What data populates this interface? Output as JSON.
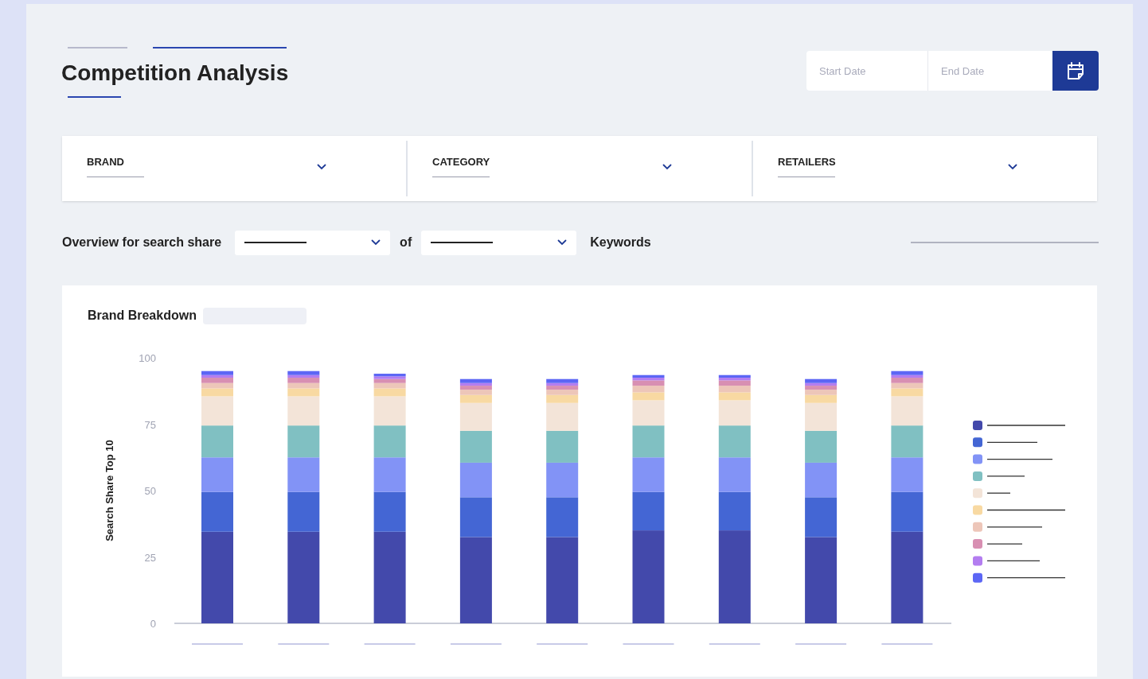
{
  "tabs": [
    {
      "selected": false
    },
    {
      "selected": true
    }
  ],
  "title": "Competition Analysis",
  "date_range": {
    "start_placeholder": "Start Date",
    "end_placeholder": "End Date"
  },
  "filters": [
    {
      "label": "BRAND"
    },
    {
      "label": "CATEGORY"
    },
    {
      "label": "RETAILERS"
    }
  ],
  "overview": {
    "label": "Overview for search share",
    "connector": "of",
    "suffix": "Keywords"
  },
  "brand_breakdown": {
    "chart_data": {
      "type": "bar",
      "stacked": true,
      "title": "Brand Breakdown",
      "ylabel": "Search Share Top 10",
      "ylim": [
        0,
        100
      ],
      "yticks": [
        0,
        25,
        50,
        75,
        100
      ],
      "series": [
        {
          "color": "#4349ab",
          "values": [
            34.5,
            34.5,
            34.5,
            32.5,
            32.5,
            35,
            35,
            32.5,
            34.5
          ]
        },
        {
          "color": "#4466d4",
          "values": [
            15,
            15,
            15,
            15,
            15,
            14.5,
            14.5,
            15,
            15
          ]
        },
        {
          "color": "#8293f6",
          "values": [
            13,
            13,
            13,
            13,
            13,
            13,
            13,
            13,
            13
          ]
        },
        {
          "color": "#80c0c2",
          "values": [
            12,
            12,
            12,
            12,
            12,
            12,
            12,
            12,
            12
          ]
        },
        {
          "color": "#f3e4d8",
          "values": [
            11,
            11,
            11,
            10.5,
            10.5,
            9.5,
            9.5,
            10.5,
            11
          ]
        },
        {
          "color": "#f8d9a2",
          "values": [
            3,
            3,
            3,
            3,
            3,
            3,
            3,
            3,
            3
          ]
        },
        {
          "color": "#edc6b9",
          "values": [
            2,
            2,
            2,
            2,
            2,
            2.5,
            2.5,
            2,
            2
          ]
        },
        {
          "color": "#d88fb2",
          "values": [
            2,
            2,
            1.5,
            1.5,
            1.5,
            2,
            2,
            1.5,
            2
          ]
        },
        {
          "color": "#b37df0",
          "values": [
            1,
            1,
            1,
            1,
            1,
            1,
            1,
            1,
            1
          ]
        },
        {
          "color": "#5c66f5",
          "values": [
            1.5,
            1.5,
            1,
            1.5,
            1.5,
            1,
            1,
            1.5,
            1.5
          ]
        }
      ]
    }
  }
}
